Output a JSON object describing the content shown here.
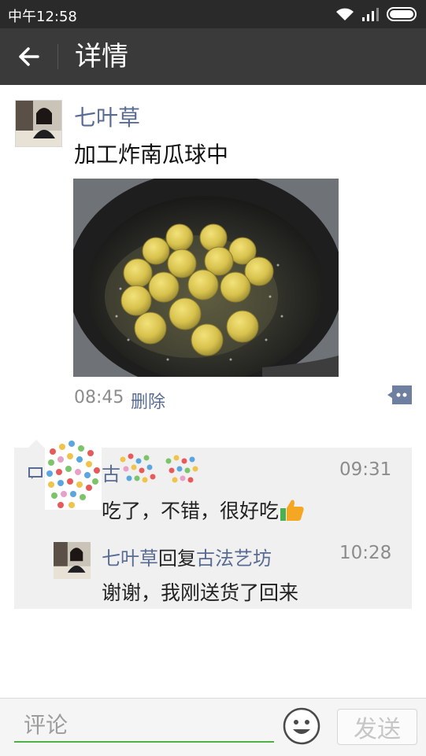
{
  "status_bar": {
    "time": "中午12:58"
  },
  "header": {
    "title": "详情",
    "back_icon": "back-arrow-icon"
  },
  "post": {
    "author": "七叶草",
    "text": "加工炸南瓜球中",
    "photo_subject": "fried-pumpkin-balls-in-wok",
    "time": "08:45",
    "delete_label": "删除",
    "more_icon": "comment-bubble-icon"
  },
  "comments": [
    {
      "author": "古",
      "time": "09:31",
      "text": "吃了，不错，很好吃",
      "emoji": "thumbs-up-icon"
    },
    {
      "author": "七叶草",
      "reply_word": "回复",
      "reply_to": "古法艺坊",
      "time": "10:28",
      "text": "谢谢，我刚送货了回来"
    }
  ],
  "composer": {
    "placeholder": "评论",
    "send_label": "发送",
    "emoji_icon": "smiley-icon"
  },
  "colors": {
    "link": "#586c93",
    "accent_green": "#4fb046",
    "header_bg": "#3a3a3a"
  }
}
